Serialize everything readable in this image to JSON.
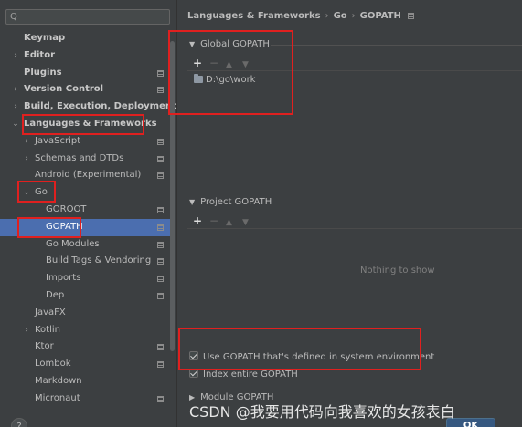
{
  "search": {
    "icon": "search-icon",
    "placeholder": "",
    "value": ""
  },
  "sidebar": {
    "items": [
      {
        "label": "Keymap",
        "indent": 0,
        "arrow": "",
        "bold": true,
        "pin": false,
        "selected": false
      },
      {
        "label": "Editor",
        "indent": 0,
        "arrow": ">",
        "bold": true,
        "pin": false,
        "selected": false
      },
      {
        "label": "Plugins",
        "indent": 0,
        "arrow": "",
        "bold": true,
        "pin": true,
        "selected": false
      },
      {
        "label": "Version Control",
        "indent": 0,
        "arrow": ">",
        "bold": true,
        "pin": true,
        "selected": false
      },
      {
        "label": "Build, Execution, Deployment",
        "indent": 0,
        "arrow": ">",
        "bold": true,
        "pin": false,
        "selected": false
      },
      {
        "label": "Languages & Frameworks",
        "indent": 0,
        "arrow": "v",
        "bold": true,
        "pin": false,
        "selected": false
      },
      {
        "label": "JavaScript",
        "indent": 1,
        "arrow": ">",
        "bold": false,
        "pin": true,
        "selected": false
      },
      {
        "label": "Schemas and DTDs",
        "indent": 1,
        "arrow": ">",
        "bold": false,
        "pin": true,
        "selected": false
      },
      {
        "label": "Android (Experimental)",
        "indent": 1,
        "arrow": "",
        "bold": false,
        "pin": true,
        "selected": false
      },
      {
        "label": "Go",
        "indent": 1,
        "arrow": "v",
        "bold": false,
        "pin": false,
        "selected": false
      },
      {
        "label": "GOROOT",
        "indent": 2,
        "arrow": "",
        "bold": false,
        "pin": true,
        "selected": false
      },
      {
        "label": "GOPATH",
        "indent": 2,
        "arrow": "",
        "bold": false,
        "pin": true,
        "selected": true
      },
      {
        "label": "Go Modules",
        "indent": 2,
        "arrow": "",
        "bold": false,
        "pin": true,
        "selected": false
      },
      {
        "label": "Build Tags & Vendoring",
        "indent": 2,
        "arrow": "",
        "bold": false,
        "pin": true,
        "selected": false
      },
      {
        "label": "Imports",
        "indent": 2,
        "arrow": "",
        "bold": false,
        "pin": true,
        "selected": false
      },
      {
        "label": "Dep",
        "indent": 2,
        "arrow": "",
        "bold": false,
        "pin": true,
        "selected": false
      },
      {
        "label": "JavaFX",
        "indent": 1,
        "arrow": "",
        "bold": false,
        "pin": false,
        "selected": false
      },
      {
        "label": "Kotlin",
        "indent": 1,
        "arrow": ">",
        "bold": false,
        "pin": false,
        "selected": false
      },
      {
        "label": "Ktor",
        "indent": 1,
        "arrow": "",
        "bold": false,
        "pin": true,
        "selected": false
      },
      {
        "label": "Lombok",
        "indent": 1,
        "arrow": "",
        "bold": false,
        "pin": true,
        "selected": false
      },
      {
        "label": "Markdown",
        "indent": 1,
        "arrow": "",
        "bold": false,
        "pin": false,
        "selected": false
      },
      {
        "label": "Micronaut",
        "indent": 1,
        "arrow": "",
        "bold": false,
        "pin": true,
        "selected": false
      }
    ]
  },
  "breadcrumb": {
    "part1": "Languages & Frameworks",
    "sep": "›",
    "part2": "Go",
    "part3": "GOPATH"
  },
  "global_gopath": {
    "title": "Global GOPATH",
    "toolbar": {
      "add": "+",
      "remove": "−",
      "up": "▲",
      "down": "▼"
    },
    "entries": [
      "D:\\go\\work"
    ]
  },
  "project_gopath": {
    "title": "Project GOPATH",
    "toolbar": {
      "add": "+",
      "remove": "−",
      "up": "▲",
      "down": "▼"
    },
    "empty_text": "Nothing to show"
  },
  "options": {
    "use_system_gopath": {
      "label": "Use GOPATH that's defined in system environment",
      "checked": true
    },
    "index_entire_gopath": {
      "label": "Index entire GOPATH",
      "checked": true
    }
  },
  "module_gopath": {
    "title": "Module GOPATH"
  },
  "footer": {
    "help": "?",
    "ok": "OK"
  },
  "watermark": "CSDN @我要用代码向我喜欢的女孩表白",
  "colors": {
    "background": "#3c3f41",
    "selection": "#4b6eaf",
    "highlight": "#e0201f"
  }
}
